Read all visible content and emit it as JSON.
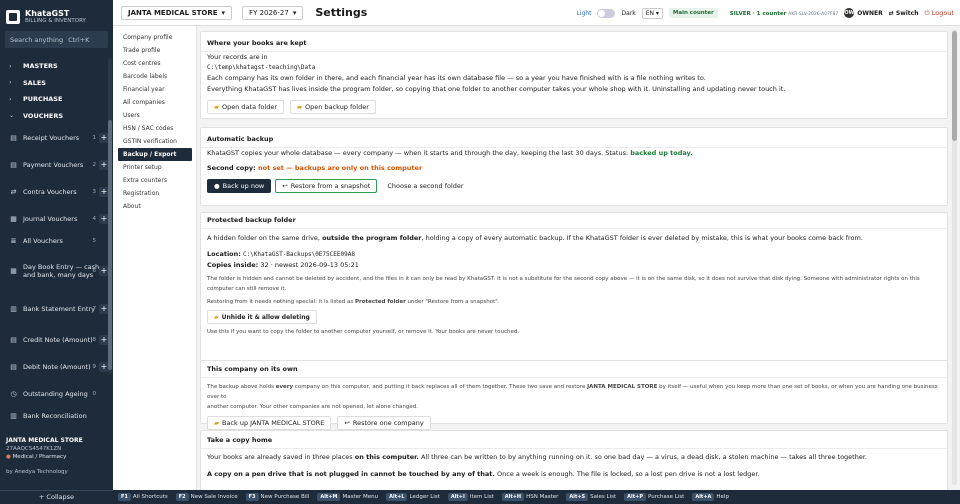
{
  "brand": {
    "name": "KhataGST",
    "sub": "BILLING & INVENTORY"
  },
  "search": {
    "placeholder": "Search anything",
    "shortcut": "Ctrl+K"
  },
  "sidebar": {
    "groups": [
      {
        "label": "MASTERS"
      },
      {
        "label": "SALES"
      },
      {
        "label": "PURCHASE"
      },
      {
        "label": "VOUCHERS"
      }
    ],
    "vouchers": [
      {
        "label": "Receipt Vouchers",
        "num": "1"
      },
      {
        "label": "Payment Vouchers",
        "num": "2"
      },
      {
        "label": "Contra Vouchers",
        "num": "3"
      },
      {
        "label": "Journal Vouchers",
        "num": "4"
      },
      {
        "label": "All Vouchers",
        "num": "5"
      },
      {
        "label": "Day Book Entry — cash and bank, many days",
        "num": "6"
      },
      {
        "label": "Bank Statement Entry",
        "num": "7"
      },
      {
        "label": "Credit Note (Amount)",
        "num": "8"
      },
      {
        "label": "Debit Note (Amount)",
        "num": "9"
      },
      {
        "label": "Outstanding Ageing",
        "num": "0"
      },
      {
        "label": "Bank Reconciliation",
        "num": ""
      }
    ],
    "company": {
      "name": "JANTA MEDICAL STORE",
      "gstin": "27AAQCS4547K1ZN",
      "type": "Medical / Pharmacy",
      "by": "by Anedya Technology"
    },
    "collapse": "+ Collapse"
  },
  "topbar": {
    "company": "JANTA MEDICAL STORE",
    "fy": "FY 2026-27",
    "title": "Settings",
    "light": "Light",
    "dark": "Dark",
    "lang": "EN",
    "counter": "Main counter",
    "silver": "SILVER · 1 counter",
    "code": "AKR-SLV-2026-A07F87",
    "owner": "OWNER",
    "switch": "Switch",
    "logout": "Logout"
  },
  "settings_nav": [
    "Company profile",
    "Trade profile",
    "Cost centres",
    "Barcode labels",
    "Financial year",
    "All companies",
    "Users",
    "HSN / SAC codes",
    "GSTIN verification",
    "Backup / Export",
    "Printer setup",
    "Extra counters",
    "Registration",
    "About"
  ],
  "card1": {
    "title": "Where your books are kept",
    "l1": "Your records are in",
    "path": "C:\\temp\\khatagst-teaching\\Data",
    "l2": "Each company has its own folder in there, and each financial year has its own database file — so a year you have finished with is a file nothing writes to.",
    "l3": "Everything KhataGST has lives inside the program folder, so copying that one folder to another computer takes your whole shop with it. Uninstalling and updating never touch it.",
    "b1": "Open data folder",
    "b2": "Open backup folder"
  },
  "card2": {
    "title": "Automatic backup",
    "l1": "KhataGST copies your whole database — every company — when it starts and through the day, keeping the last 30 days. Status:",
    "status": "backed up today.",
    "second_label": "Second copy:",
    "second_val": "not set — backups are only on this computer",
    "b1": "Back up now",
    "b2": "Restore from a snapshot",
    "b3": "Choose a second folder"
  },
  "card3": {
    "title": "Protected backup folder",
    "l1a": "A hidden folder on the same drive,",
    "l1b": "outside the program folder",
    "l1c": ", holding a copy of every automatic backup. If the KhataGST folder is ever deleted by mistake, this is what your books come back from.",
    "loc_label": "Location:",
    "loc": "C:\\KhataGST-Backups\\0E75CEE09A8",
    "copies_label": "Copies inside:",
    "copies": "32 · newest 2026-09-13 05:21",
    "p1": "The folder is hidden and cannot be deleted by accident, and the files in it can only be read by KhataGST. It is not a substitute for the second copy above — it is on the same disk, so it does not survive that disk dying. Someone with administrator rights on this computer can still remove it.",
    "p2a": "Restoring from it needs nothing special: it is listed as",
    "p2b": "Protected folder",
    "p2c": "under \"Restore from a snapshot\".",
    "b1": "Unhide it & allow deleting",
    "p3": "Use this if you want to copy the folder to another computer yourself, or remove it. Your books are never touched."
  },
  "card4": {
    "title": "This company on its own",
    "p1a": "The backup above holds",
    "p1b": "every",
    "p1c": "company on this computer, and putting it back replaces all of them together. These two save and restore",
    "p1d": "JANTA MEDICAL STORE",
    "p1e": "by itself — useful when you keep more than one set of books, or when you are handing one business over to",
    "p2": "another computer. Your other companies are not opened, let alone changed.",
    "b1": "Back up JANTA MEDICAL STORE",
    "b2": "Restore one company"
  },
  "card5": {
    "title": "Take a copy home",
    "p1a": "Your books are already saved in three places",
    "p1b": "on this computer.",
    "p1c": "All three can be written to by anything running on it. so one bad day — a virus, a dead disk, a stolen machine — takes all three together.",
    "p2a": "A copy on a pen drive that is not plugged in cannot be touched by any of that.",
    "p2b": "Once a week is enough. The file is locked, so a lost pen drive is not a lost ledger."
  },
  "bottombar": [
    {
      "key": "F1",
      "label": "All Shortcuts"
    },
    {
      "key": "F2",
      "label": "New Sale Invoice"
    },
    {
      "key": "F3",
      "label": "New Purchase Bill"
    },
    {
      "key": "Alt+M",
      "label": "Master Menu"
    },
    {
      "key": "Alt+L",
      "label": "Ledger List"
    },
    {
      "key": "Alt+I",
      "label": "Item List"
    },
    {
      "key": "Alt+H",
      "label": "HSN Master"
    },
    {
      "key": "Alt+S",
      "label": "Sales List"
    },
    {
      "key": "Alt+P",
      "label": "Purchase List"
    },
    {
      "key": "Alt+A",
      "label": "Help"
    }
  ]
}
